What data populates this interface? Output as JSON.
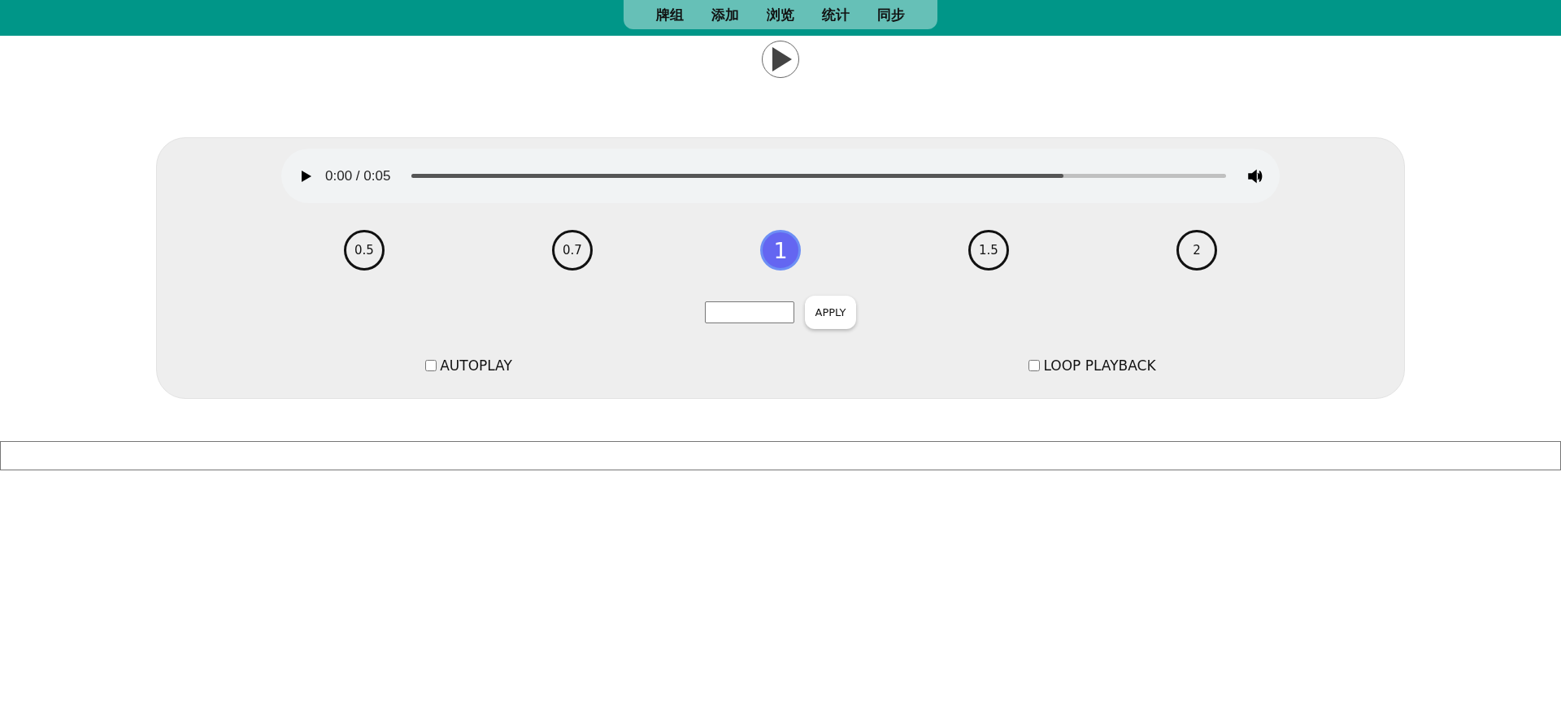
{
  "nav": {
    "items": [
      {
        "label": "牌组"
      },
      {
        "label": "添加"
      },
      {
        "label": "浏览"
      },
      {
        "label": "统计"
      },
      {
        "label": "同步"
      }
    ]
  },
  "player": {
    "time": "0:00 / 0:05",
    "level": 0.8
  },
  "speeds": [
    {
      "label": "0.5",
      "selected": false
    },
    {
      "label": "0.7",
      "selected": false
    },
    {
      "label": "1",
      "selected": true
    },
    {
      "label": "1.5",
      "selected": false
    },
    {
      "label": "2",
      "selected": false
    }
  ],
  "apply_button": "APPLY",
  "options": [
    {
      "label": "AUTOPLAY",
      "checked": false
    },
    {
      "label": "LOOP PLAYBACK",
      "checked": false
    }
  ]
}
